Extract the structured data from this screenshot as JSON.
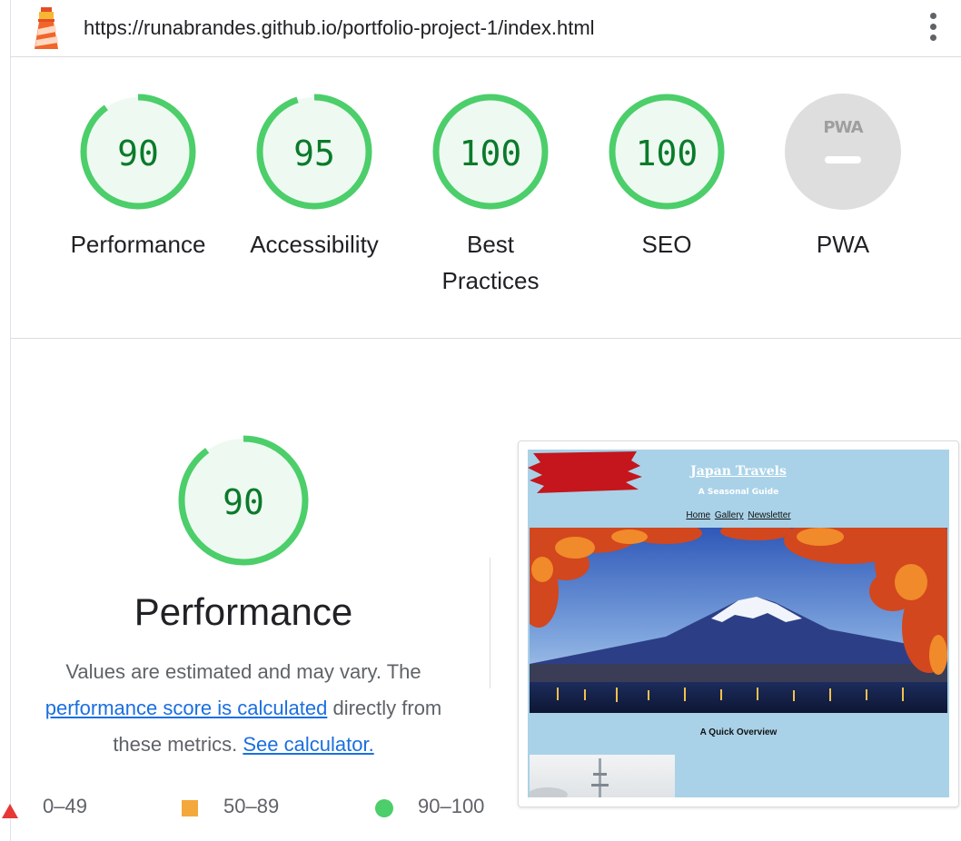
{
  "url_bar": {
    "url": "https://runabrandes.github.io/portfolio-project-1/index.html",
    "logo_icon": "lighthouse-icon",
    "menu_icon": "more-vertical-icon"
  },
  "gauges": [
    {
      "id": "performance",
      "score": 90,
      "label": "Performance"
    },
    {
      "id": "accessibility",
      "score": 95,
      "label": "Accessibility"
    },
    {
      "id": "best-practices",
      "score": 100,
      "label_line1": "Best",
      "label_line2": "Practices"
    },
    {
      "id": "seo",
      "score": 100,
      "label": "SEO"
    },
    {
      "id": "pwa",
      "badge": "PWA",
      "label": "PWA"
    }
  ],
  "performance": {
    "score": 90,
    "title": "Performance",
    "desc_part1": "Values are estimated and may vary. The",
    "link1": "performance score is calculated",
    "desc_part2": "directly from these metrics.",
    "link2": "See calculator."
  },
  "legend": [
    {
      "range": "0–49",
      "shape": "triangle",
      "color": "#e53935"
    },
    {
      "range": "50–89",
      "shape": "square",
      "color": "#f4a83b"
    },
    {
      "range": "90–100",
      "shape": "circle",
      "color": "#4cce6a"
    }
  ],
  "colors": {
    "pass_ring": "#4cce6a",
    "pass_text": "#0b7a2b",
    "pass_fill": "#eefaf1",
    "link": "#1a6fe0"
  },
  "screenshot": {
    "site_title": "Japan Travels",
    "site_subtitle": "A Seasonal Guide",
    "nav": [
      "Home",
      "Gallery",
      "Newsletter"
    ],
    "overview": "A Quick Overview"
  }
}
